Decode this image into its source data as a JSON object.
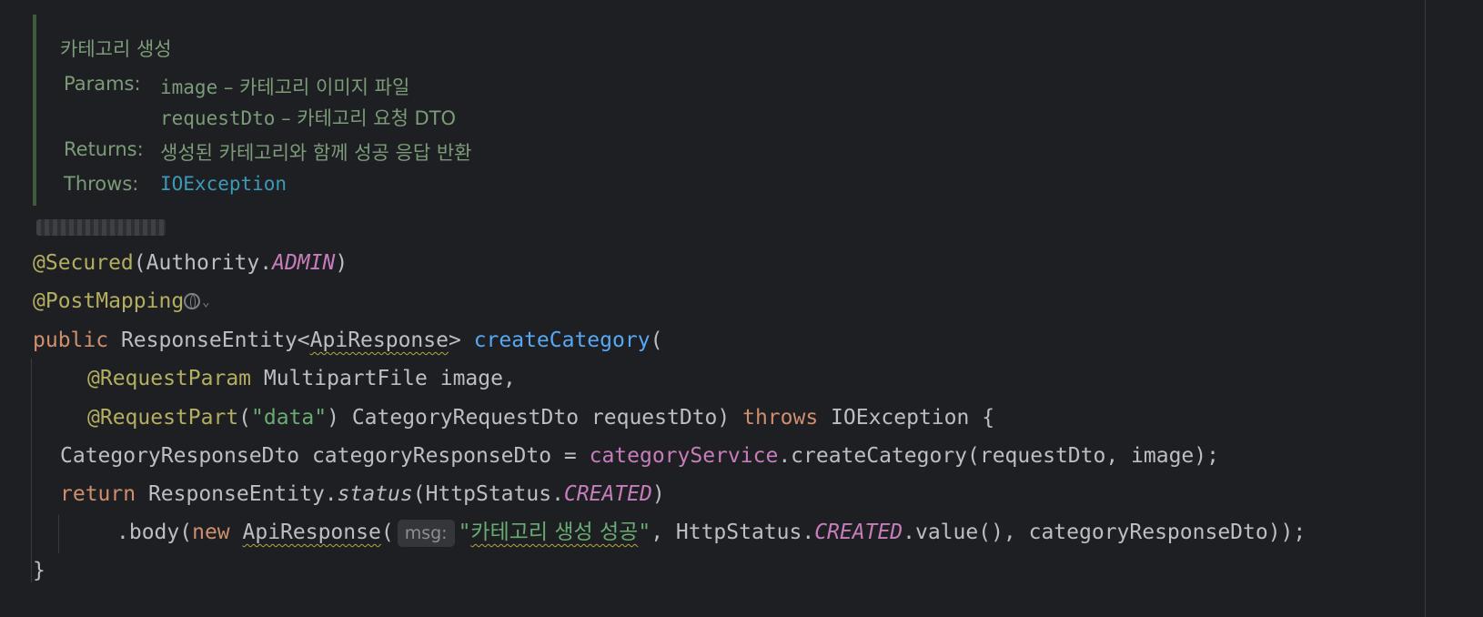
{
  "doc": {
    "summary": "카테고리 생성",
    "params_tag": "Params:",
    "param1_name": "image",
    "param1_desc": " – 카테고리 이미지 파일",
    "param2_name": "requestDto",
    "param2_desc": " – 카테고리 요청 DTO",
    "returns_tag": "Returns:",
    "returns_desc": "생성된 카테고리와 함께 성공 응답 반환",
    "throws_tag": "Throws:",
    "throws_link": "IOException"
  },
  "code": {
    "secured_ann": "@Secured",
    "secured_open": "(Authority.",
    "secured_field": "ADMIN",
    "secured_close": ")",
    "postmapping_ann": "@PostMapping",
    "public_kw": "public",
    "return_type_a": " ResponseEntity<",
    "return_type_b": "ApiResponse",
    "return_type_c": "> ",
    "method_name": "createCategory",
    "method_open": "(",
    "reqparam_ann": "@RequestParam",
    "reqparam_rest": " MultipartFile image,",
    "reqpart_ann": "@RequestPart",
    "reqpart_paren_open": "(",
    "reqpart_str": "\"data\"",
    "reqpart_rest": ") CategoryRequestDto requestDto) ",
    "throws_kw": "throws",
    "throws_rest": " IOException {",
    "line7_a": "CategoryResponseDto categoryResponseDto = ",
    "line7_field": "categoryService",
    "line7_b": ".createCategory(requestDto, image);",
    "return_kw": "return",
    "line8_a": " ResponseEntity.",
    "line8_status": "status",
    "line8_b": "(HttpStatus.",
    "line8_created": "CREATED",
    "line8_c": ")",
    "line9_a": ".body(",
    "new_kw": "new",
    "line9_sp": " ",
    "line9_api": "ApiResponse",
    "line9_paren": "(",
    "msg_hint": "msg:",
    "line9_str_q1": "\"",
    "line9_str_body": "카테고리 생성 성공",
    "line9_str_q2": "\"",
    "line9_b": ", HttpStatus.",
    "line9_created": "CREATED",
    "line9_c": ".value(), categoryResponseDto));",
    "closing_brace": "}"
  }
}
